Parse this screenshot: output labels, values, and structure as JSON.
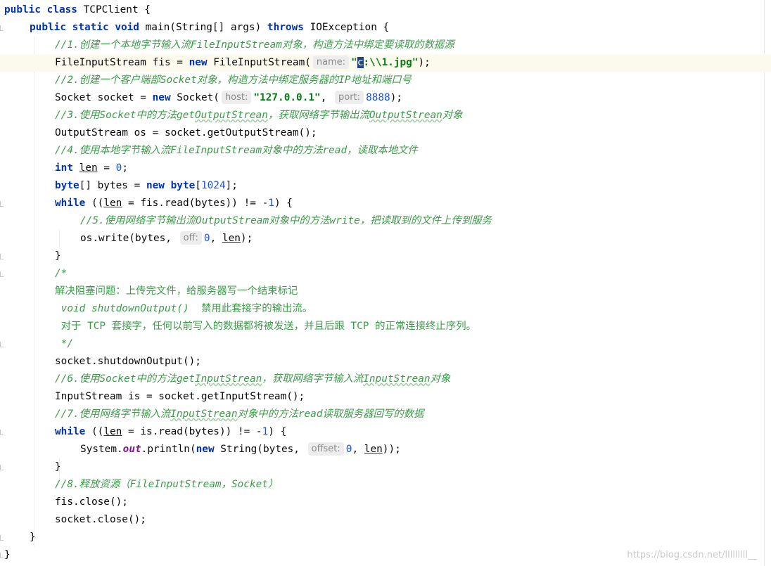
{
  "editor": {
    "lines": [
      {
        "indent": 0,
        "fold": false,
        "current": false,
        "tokens": [
          [
            "kw",
            "public"
          ],
          [
            "t",
            " "
          ],
          [
            "kw",
            "class"
          ],
          [
            "t",
            " TCPClient {"
          ]
        ]
      },
      {
        "indent": 1,
        "fold": true,
        "current": false,
        "tokens": [
          [
            "kw",
            "public"
          ],
          [
            "t",
            " "
          ],
          [
            "kw",
            "static"
          ],
          [
            "t",
            " "
          ],
          [
            "kw",
            "void"
          ],
          [
            "t",
            " main(String[] args) "
          ],
          [
            "kw",
            "throws"
          ],
          [
            "t",
            " IOException {"
          ]
        ]
      },
      {
        "indent": 2,
        "fold": false,
        "current": false,
        "tokens": [
          [
            "cmt",
            "//1.创建一个本地字节输入流FileInputStream对象，构造方法中绑定要读取的数据源"
          ]
        ]
      },
      {
        "indent": 2,
        "fold": false,
        "current": true,
        "tokens": [
          [
            "t",
            "FileInputStream fis = "
          ],
          [
            "kw",
            "new"
          ],
          [
            "t",
            " FileInputStream("
          ],
          [
            "hint",
            "name:"
          ],
          [
            "str",
            "\""
          ],
          [
            "caret",
            "c"
          ],
          [
            "str",
            ":\\\\1.jpg\""
          ],
          [
            "t",
            ");"
          ]
        ]
      },
      {
        "indent": 2,
        "fold": false,
        "current": false,
        "tokens": [
          [
            "cmt",
            "//2.创建一个客户端部Socket对象，构造方法中绑定服务器的IP地址和端口号"
          ]
        ]
      },
      {
        "indent": 2,
        "fold": false,
        "current": false,
        "tokens": [
          [
            "t",
            "Socket socket = "
          ],
          [
            "kw",
            "new"
          ],
          [
            "t",
            " Socket("
          ],
          [
            "hint",
            "host:"
          ],
          [
            "str",
            "\"127.0.0.1\""
          ],
          [
            "t",
            ", "
          ],
          [
            "hint",
            "port:"
          ],
          [
            "num",
            "8888"
          ],
          [
            "t",
            ");"
          ]
        ]
      },
      {
        "indent": 2,
        "fold": false,
        "current": false,
        "tokens": [
          [
            "cmt",
            "//3.使用Socket中的方法get"
          ],
          [
            "cmtw",
            "OutputStrean"
          ],
          [
            "cmt",
            "，获取网络字节输出流"
          ],
          [
            "cmtw",
            "OutputStrean"
          ],
          [
            "cmt",
            "对象"
          ]
        ]
      },
      {
        "indent": 2,
        "fold": false,
        "current": false,
        "tokens": [
          [
            "t",
            "OutputStream os = socket.getOutputStream();"
          ]
        ]
      },
      {
        "indent": 2,
        "fold": false,
        "current": false,
        "tokens": [
          [
            "cmt",
            "//4.使用本地字节输入流FileInputStream对象中的方法read，读取本地文件"
          ]
        ]
      },
      {
        "indent": 2,
        "fold": false,
        "current": false,
        "tokens": [
          [
            "kw",
            "int"
          ],
          [
            "t",
            " "
          ],
          [
            "ul",
            "len"
          ],
          [
            "t",
            " = "
          ],
          [
            "num",
            "0"
          ],
          [
            "t",
            ";"
          ]
        ]
      },
      {
        "indent": 2,
        "fold": false,
        "current": false,
        "tokens": [
          [
            "kw",
            "byte"
          ],
          [
            "t",
            "[] bytes = "
          ],
          [
            "kw",
            "new"
          ],
          [
            "t",
            " "
          ],
          [
            "kw",
            "byte"
          ],
          [
            "t",
            "["
          ],
          [
            "num",
            "1024"
          ],
          [
            "t",
            "];"
          ]
        ]
      },
      {
        "indent": 2,
        "fold": true,
        "current": false,
        "tokens": [
          [
            "kw",
            "while"
          ],
          [
            "t",
            " (("
          ],
          [
            "ul",
            "len"
          ],
          [
            "t",
            " = fis.read(bytes)) != -"
          ],
          [
            "num",
            "1"
          ],
          [
            "t",
            ") {"
          ]
        ]
      },
      {
        "indent": 3,
        "fold": false,
        "current": false,
        "tokens": [
          [
            "cmt",
            "//5.使用网络字节输出流OutputStream对象中的方法write，把读取到的文件上传到服务"
          ]
        ]
      },
      {
        "indent": 3,
        "fold": false,
        "current": false,
        "tokens": [
          [
            "t",
            "os.write(bytes, "
          ],
          [
            "hint",
            "off:"
          ],
          [
            "num",
            "0"
          ],
          [
            "t",
            ", "
          ],
          [
            "ul",
            "len"
          ],
          [
            "t",
            ");"
          ]
        ]
      },
      {
        "indent": 2,
        "fold": true,
        "current": false,
        "tokens": [
          [
            "t",
            "}"
          ]
        ]
      },
      {
        "indent": 2,
        "fold": true,
        "current": false,
        "tokens": [
          [
            "cmt",
            "/*"
          ]
        ]
      },
      {
        "indent": 2,
        "fold": false,
        "current": false,
        "tokens": [
          [
            "cmtn",
            "解决阻塞问题：上传完文件，给服务器写一个结束标记"
          ]
        ]
      },
      {
        "indent": 2,
        "fold": false,
        "current": false,
        "tokens": [
          [
            "cmtn",
            " "
          ],
          [
            "cmt",
            "void shutdownOutput()"
          ],
          [
            "cmtn",
            "  禁用此套接字的输出流。"
          ]
        ]
      },
      {
        "indent": 2,
        "fold": false,
        "current": false,
        "tokens": [
          [
            "cmtn",
            " 对于 TCP 套接字，任何以前写入的数据都将被发送，并且后跟 TCP 的正常连接终止序列。"
          ]
        ]
      },
      {
        "indent": 2,
        "fold": true,
        "current": false,
        "tokens": [
          [
            "cmt",
            " */"
          ]
        ]
      },
      {
        "indent": 2,
        "fold": false,
        "current": false,
        "tokens": [
          [
            "t",
            "socket.shutdownOutput();"
          ]
        ]
      },
      {
        "indent": 2,
        "fold": false,
        "current": false,
        "tokens": [
          [
            "cmt",
            "//6.使用Socket中的方法get"
          ],
          [
            "cmtw",
            "InputStrean"
          ],
          [
            "cmt",
            "，获取网络字节输入流"
          ],
          [
            "cmtw",
            "InputStrean"
          ],
          [
            "cmt",
            "对象"
          ]
        ]
      },
      {
        "indent": 2,
        "fold": false,
        "current": false,
        "tokens": [
          [
            "t",
            "InputStream is = socket.getInputStream();"
          ]
        ]
      },
      {
        "indent": 2,
        "fold": false,
        "current": false,
        "tokens": [
          [
            "cmt",
            "//7.使用网络字节输入流"
          ],
          [
            "cmtw",
            "InputStrean"
          ],
          [
            "cmt",
            "对象中的方法read读取服务器回写的数据"
          ]
        ]
      },
      {
        "indent": 2,
        "fold": true,
        "current": false,
        "tokens": [
          [
            "kw",
            "while"
          ],
          [
            "t",
            " (("
          ],
          [
            "ul",
            "len"
          ],
          [
            "t",
            " = is.read(bytes)) != -"
          ],
          [
            "num",
            "1"
          ],
          [
            "t",
            ") {"
          ]
        ]
      },
      {
        "indent": 3,
        "fold": false,
        "current": false,
        "tokens": [
          [
            "t",
            "System."
          ],
          [
            "fld",
            "out"
          ],
          [
            "t",
            ".println("
          ],
          [
            "kw",
            "new"
          ],
          [
            "t",
            " String(bytes, "
          ],
          [
            "hint",
            "offset:"
          ],
          [
            "num",
            "0"
          ],
          [
            "t",
            ", "
          ],
          [
            "ul",
            "len"
          ],
          [
            "t",
            "));"
          ]
        ]
      },
      {
        "indent": 2,
        "fold": true,
        "current": false,
        "tokens": [
          [
            "t",
            "}"
          ]
        ]
      },
      {
        "indent": 2,
        "fold": false,
        "current": false,
        "tokens": [
          [
            "cmt",
            "//8.释放资源（FileInputStream，Socket）"
          ]
        ]
      },
      {
        "indent": 2,
        "fold": false,
        "current": false,
        "tokens": [
          [
            "t",
            "fis.close();"
          ]
        ]
      },
      {
        "indent": 2,
        "fold": false,
        "current": false,
        "tokens": [
          [
            "t",
            "socket.close();"
          ]
        ]
      },
      {
        "indent": 1,
        "fold": true,
        "current": false,
        "tokens": [
          [
            "t",
            "}"
          ]
        ]
      },
      {
        "indent": 0,
        "fold": true,
        "current": false,
        "tokens": [
          [
            "t",
            "}"
          ]
        ]
      }
    ]
  },
  "watermark": "https://blog.csdn.net/lllllllll__"
}
